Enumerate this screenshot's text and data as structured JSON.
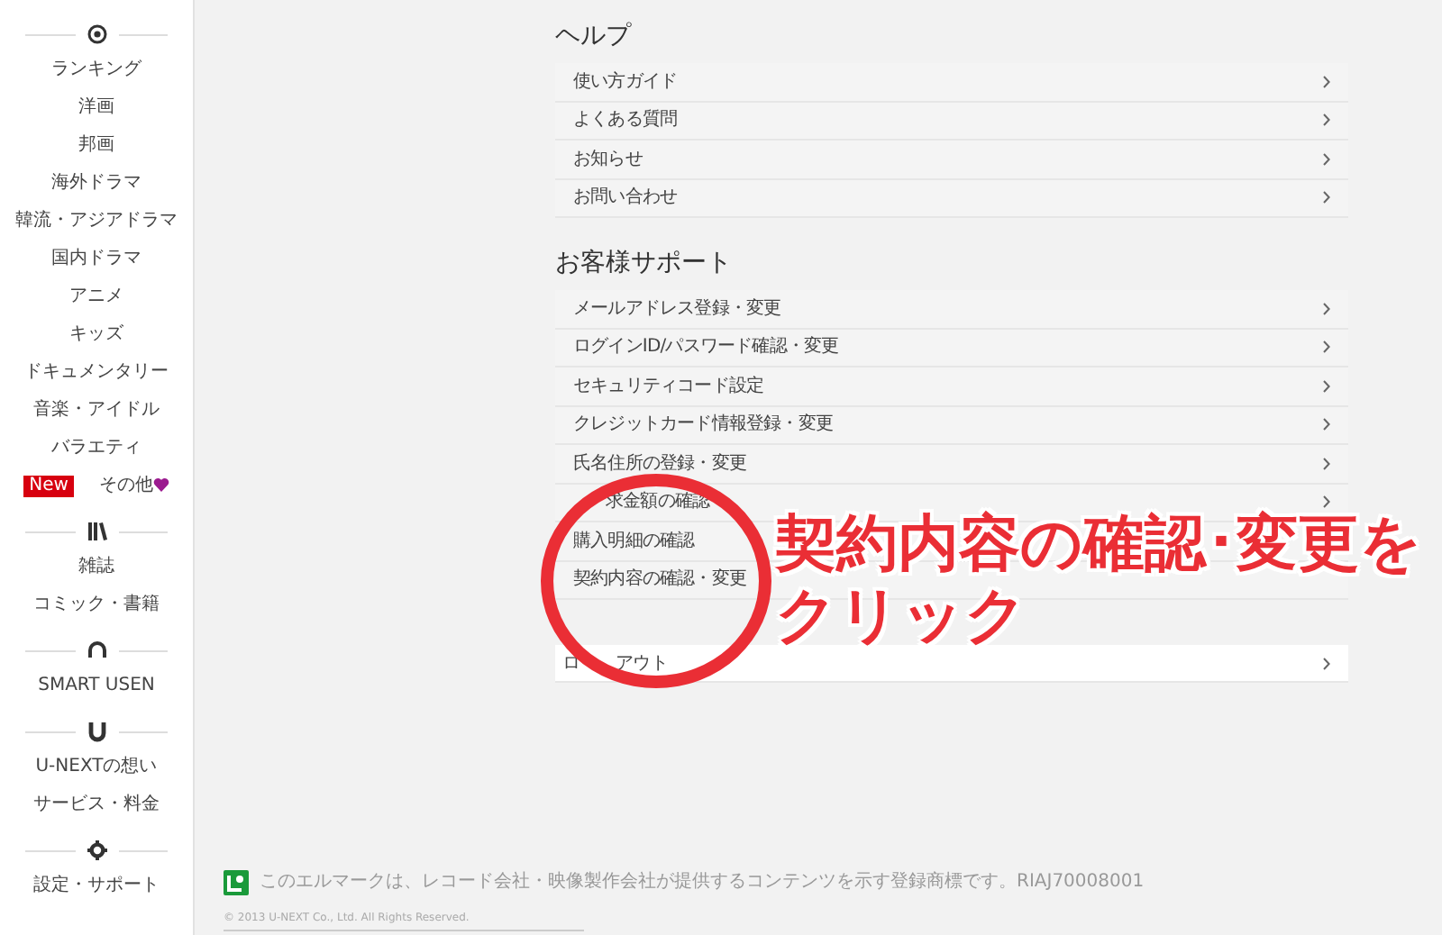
{
  "sidebar": {
    "sections": [
      {
        "items": [
          {
            "label": "ランキング"
          },
          {
            "label": "洋画"
          },
          {
            "label": "邦画"
          },
          {
            "label": "海外ドラマ"
          },
          {
            "label": "韓流・アジアドラマ"
          },
          {
            "label": "国内ドラマ"
          },
          {
            "label": "アニメ"
          },
          {
            "label": "キッズ"
          },
          {
            "label": "ドキュメンタリー"
          },
          {
            "label": "音楽・アイドル"
          },
          {
            "label": "バラエティ"
          },
          {
            "label": "その他",
            "badge": "New",
            "heart": true
          }
        ]
      },
      {
        "items": [
          {
            "label": "雑誌"
          },
          {
            "label": "コミック・書籍"
          }
        ]
      },
      {
        "items": [
          {
            "label": "SMART USEN"
          }
        ]
      },
      {
        "items": [
          {
            "label": "U-NEXTの想い"
          },
          {
            "label": "サービス・料金"
          }
        ]
      },
      {
        "items": [
          {
            "label": "設定・サポート"
          }
        ]
      }
    ]
  },
  "main": {
    "sections": [
      {
        "title": "ヘルプ",
        "items": [
          {
            "label": "使い方ガイド"
          },
          {
            "label": "よくある質問"
          },
          {
            "label": "お知らせ"
          },
          {
            "label": "お問い合わせ"
          }
        ]
      },
      {
        "title": "お客様サポート",
        "items": [
          {
            "label": "メールアドレス登録・変更"
          },
          {
            "label": "ログインID/パスワード確認・変更"
          },
          {
            "label": "セキュリティコード設定"
          },
          {
            "label": "クレジットカード情報登録・変更"
          },
          {
            "label": "氏名住所の登録・変更"
          },
          {
            "label": "求金額の確認",
            "covered_start": true
          },
          {
            "label": "購入明細の確認",
            "chevron_covered": true
          },
          {
            "label": "契約内容の確認・変更",
            "chevron_covered": true
          }
        ]
      }
    ],
    "logout": {
      "parts": [
        "ロ",
        "アウト"
      ]
    }
  },
  "annotation": {
    "lines": [
      "契約内容の確認･変更を",
      "クリック"
    ]
  },
  "footer": {
    "notice": "このエルマークは、レコード会社・映像製作会社が提供するコンテンツを示す登録商標です。RIAJ70008001",
    "copyright": "© 2013 U-NEXT Co., Ltd. All Rights Reserved."
  }
}
